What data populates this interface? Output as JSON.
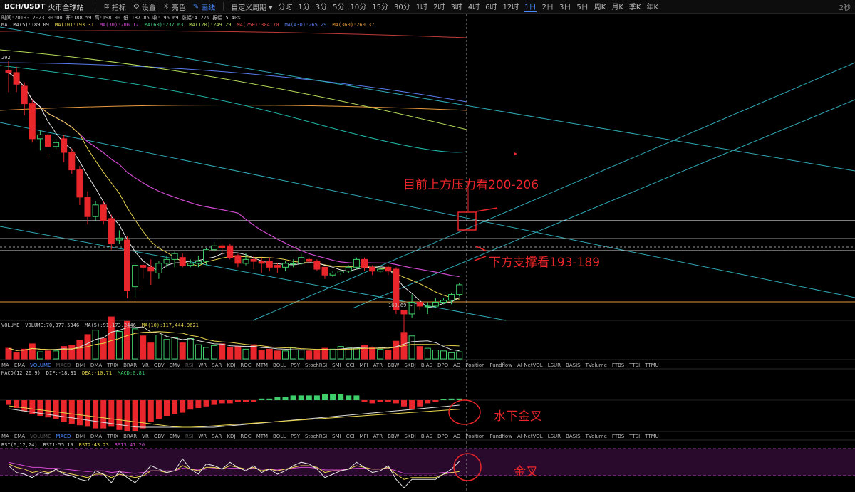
{
  "header": {
    "symbol": "BCH/USDT",
    "exchange": "火币全球站",
    "tools": [
      {
        "label": "指标",
        "icon": "indicator-icon"
      },
      {
        "label": "设置",
        "icon": "gear-icon"
      },
      {
        "label": "亮色",
        "icon": "sun-icon"
      },
      {
        "label": "画线",
        "icon": "pencil-icon"
      }
    ],
    "custom_period": "自定义周期",
    "timeframes": [
      "分时",
      "1分",
      "3分",
      "5分",
      "10分",
      "15分",
      "30分",
      "1时",
      "2时",
      "3时",
      "4时",
      "6时",
      "12时",
      "1日",
      "2日",
      "3日",
      "5日",
      "周K",
      "月K",
      "季K",
      "年K"
    ],
    "selected_timeframe": "1日",
    "right_text": "2秒"
  },
  "info_line": "时间:2019-12-23 00:00  开:188.59  高:198.00  低:187.85  收:196.69  涨幅:4.27%  振幅:5.40%",
  "ma_line": [
    {
      "text": "MA",
      "color": "#cccccc"
    },
    {
      "text": "MA(5):189.09",
      "color": "#d8d8d8"
    },
    {
      "text": "MA(10):193.31",
      "color": "#e8d44d"
    },
    {
      "text": "MA(30):206.12",
      "color": "#d04ad0"
    },
    {
      "text": "MA(60):237.63",
      "color": "#4fd68a"
    },
    {
      "text": "MA(120):249.29",
      "color": "#b6dc5a"
    },
    {
      "text": "MA(250):304.70",
      "color": "#e04848"
    },
    {
      "text": "MA(430):265.29",
      "color": "#5a7cf0"
    },
    {
      "text": "MA(360):260.37",
      "color": "#e89a3c"
    }
  ],
  "price_labels": {
    "high_marker": "292",
    "low_marker": "169.69 →"
  },
  "volume_header": [
    {
      "text": "VOLUME",
      "color": "#cccccc"
    },
    {
      "text": "VOLUME:70,377.5346",
      "color": "#cccccc"
    },
    {
      "text": "MA(5):91,173.2446",
      "color": "#cccccc"
    },
    {
      "text": "MA(10):117,444.9621",
      "color": "#e8d44d"
    }
  ],
  "indicator_tabs": [
    "MA",
    "EMA",
    "VOLUME",
    "MACD",
    "DMI",
    "DMA",
    "TRIX",
    "BRAR",
    "VR",
    "OBV",
    "EMV",
    "RSI",
    "WR",
    "SAR",
    "KDJ",
    "ROC",
    "MTM",
    "BOLL",
    "PSY",
    "StochRSI",
    "SMI",
    "CCI",
    "MFI",
    "ATR",
    "BBW",
    "SKDJ",
    "BIAS",
    "DPO",
    "AO",
    "Position",
    "Fundflow",
    "AI-NetVOL",
    "LSUR",
    "BASIS",
    "TVolume",
    "FTBS",
    "TTSI",
    "TTMU"
  ],
  "macd_header": [
    {
      "text": "MACD(12,26,9)",
      "color": "#cccccc"
    },
    {
      "text": "DIF:-18.31",
      "color": "#cccccc"
    },
    {
      "text": "DEA:-10.71",
      "color": "#e8d44d"
    },
    {
      "text": "MACD:0.81",
      "color": "#3ecf6a"
    }
  ],
  "rsi_header": [
    {
      "text": "RSI(6,12,24)",
      "color": "#cccccc"
    },
    {
      "text": "RSI1:55.19",
      "color": "#cccccc"
    },
    {
      "text": "RSI2:43.23",
      "color": "#e8d44d"
    },
    {
      "text": "RSI3:41.20",
      "color": "#d04ad0"
    }
  ],
  "annotations": {
    "resistance": "目前上方压力看200-206",
    "support": "下方支撑看193-189",
    "macd_cross": "水下金叉",
    "rsi_cross": "金叉"
  },
  "colors": {
    "up": "#3ecf6a",
    "down": "#e8262b",
    "annotation": "#e8262b",
    "accent": "#4a8cff"
  },
  "candles": [
    [
      286,
      287,
      276,
      292
    ],
    [
      280,
      286,
      276,
      289
    ],
    [
      270,
      279,
      264,
      281
    ],
    [
      252,
      270,
      250,
      272
    ],
    [
      254,
      252,
      246,
      256
    ],
    [
      248,
      254,
      244,
      258
    ],
    [
      250,
      248,
      246,
      252
    ],
    [
      245,
      252,
      240,
      254
    ],
    [
      236,
      245,
      234,
      247
    ],
    [
      222,
      236,
      218,
      238
    ],
    [
      212,
      222,
      208,
      225
    ],
    [
      218,
      212,
      210,
      220
    ],
    [
      210,
      218,
      208,
      220
    ],
    [
      198,
      211,
      195,
      213
    ],
    [
      201,
      200,
      198,
      205
    ],
    [
      174,
      200,
      170,
      202
    ],
    [
      187,
      176,
      170,
      188
    ],
    [
      186,
      187,
      180,
      188
    ],
    [
      184,
      186,
      177,
      190
    ],
    [
      188,
      183,
      180,
      189
    ],
    [
      190,
      188,
      186,
      192
    ],
    [
      193,
      190,
      186,
      194
    ],
    [
      187,
      191,
      186,
      193
    ],
    [
      188,
      187,
      186,
      190
    ],
    [
      189,
      188,
      186,
      192
    ],
    [
      195,
      189,
      187,
      196
    ],
    [
      197,
      195,
      194,
      199
    ],
    [
      196,
      197,
      192,
      198
    ],
    [
      191,
      197,
      190,
      198
    ],
    [
      188,
      192,
      186,
      193
    ],
    [
      190,
      188,
      187,
      193
    ],
    [
      189,
      190,
      185,
      192
    ],
    [
      188,
      189,
      183,
      191
    ],
    [
      186,
      189,
      184,
      191
    ],
    [
      186,
      187,
      183,
      188
    ],
    [
      188,
      186,
      184,
      189
    ],
    [
      188,
      188,
      186,
      190
    ],
    [
      191,
      188,
      187,
      193
    ],
    [
      189,
      190,
      188,
      191
    ],
    [
      185,
      189,
      184,
      190
    ],
    [
      182,
      186,
      180,
      186
    ],
    [
      183,
      182,
      181,
      184
    ],
    [
      184,
      183,
      182,
      185
    ],
    [
      186,
      184,
      183,
      187
    ],
    [
      190,
      186,
      185,
      191
    ],
    [
      186,
      190,
      184,
      191
    ],
    [
      184,
      186,
      182,
      187
    ],
    [
      185,
      184,
      183,
      186
    ],
    [
      184,
      186,
      182,
      187
    ],
    [
      164,
      185,
      162,
      186
    ],
    [
      162,
      164,
      152,
      164
    ],
    [
      168,
      162,
      160,
      172
    ],
    [
      166,
      168,
      164,
      168
    ],
    [
      166,
      166,
      162,
      168
    ],
    [
      168,
      166,
      165,
      170
    ],
    [
      169,
      168,
      167,
      170
    ],
    [
      172,
      169,
      167,
      173
    ],
    [
      177,
      172,
      171,
      178
    ]
  ],
  "volumes": [
    24,
    14,
    22,
    34,
    16,
    18,
    18,
    28,
    30,
    42,
    55,
    65,
    46,
    95,
    62,
    85,
    68,
    52,
    36,
    54,
    44,
    48,
    36,
    46,
    32,
    26,
    30,
    34,
    26,
    28,
    22,
    32,
    20,
    22,
    18,
    18,
    26,
    20,
    18,
    20,
    24,
    22,
    28,
    26,
    24,
    30,
    26,
    22,
    20,
    40,
    60,
    52,
    28,
    24,
    20,
    18,
    14,
    16
  ],
  "macd_bars": [
    -3,
    -5,
    -7,
    -9,
    -10,
    -11,
    -12,
    -14,
    -15,
    -16,
    -17,
    -18,
    -18,
    -17,
    -19,
    -20,
    -20,
    -18,
    -14,
    -12,
    -10,
    -9,
    -8,
    -6,
    -5,
    -4,
    -3,
    -2,
    -2,
    -1,
    -1,
    -1,
    1,
    1,
    2,
    2,
    3,
    3,
    3,
    3,
    4,
    4,
    4,
    3,
    3,
    -1,
    -2,
    -1,
    -1,
    -2,
    -4,
    -6,
    -4,
    -2,
    -1,
    0.8,
    1,
    1
  ],
  "rsi1": [
    50,
    42,
    40,
    36,
    42,
    40,
    46,
    40,
    38,
    34,
    32,
    44,
    40,
    30,
    44,
    36,
    30,
    40,
    50,
    46,
    42,
    44,
    58,
    46,
    40,
    52,
    50,
    46,
    54,
    48,
    44,
    50,
    42,
    46,
    40,
    44,
    50,
    54,
    52,
    46,
    36,
    40,
    44,
    46,
    54,
    48,
    42,
    44,
    50,
    34,
    24,
    34,
    34,
    34,
    34,
    40,
    46,
    55
  ],
  "rsi2": [
    52,
    48,
    46,
    42,
    44,
    42,
    44,
    42,
    40,
    38,
    36,
    40,
    40,
    36,
    40,
    38,
    36,
    38,
    44,
    44,
    42,
    44,
    50,
    46,
    44,
    48,
    48,
    46,
    50,
    48,
    46,
    48,
    44,
    46,
    44,
    46,
    48,
    50,
    50,
    48,
    42,
    44,
    44,
    46,
    50,
    48,
    46,
    46,
    48,
    40,
    34,
    36,
    36,
    36,
    36,
    40,
    42,
    43
  ],
  "rsi3": [
    54,
    52,
    50,
    48,
    48,
    47,
    47,
    46,
    45,
    44,
    43,
    44,
    44,
    42,
    43,
    42,
    41,
    42,
    44,
    44,
    44,
    44,
    47,
    46,
    45,
    46,
    47,
    46,
    47,
    47,
    46,
    47,
    46,
    46,
    45,
    46,
    47,
    48,
    48,
    47,
    45,
    45,
    45,
    46,
    47,
    47,
    46,
    46,
    47,
    44,
    41,
    41,
    41,
    41,
    41,
    42,
    42,
    41
  ]
}
